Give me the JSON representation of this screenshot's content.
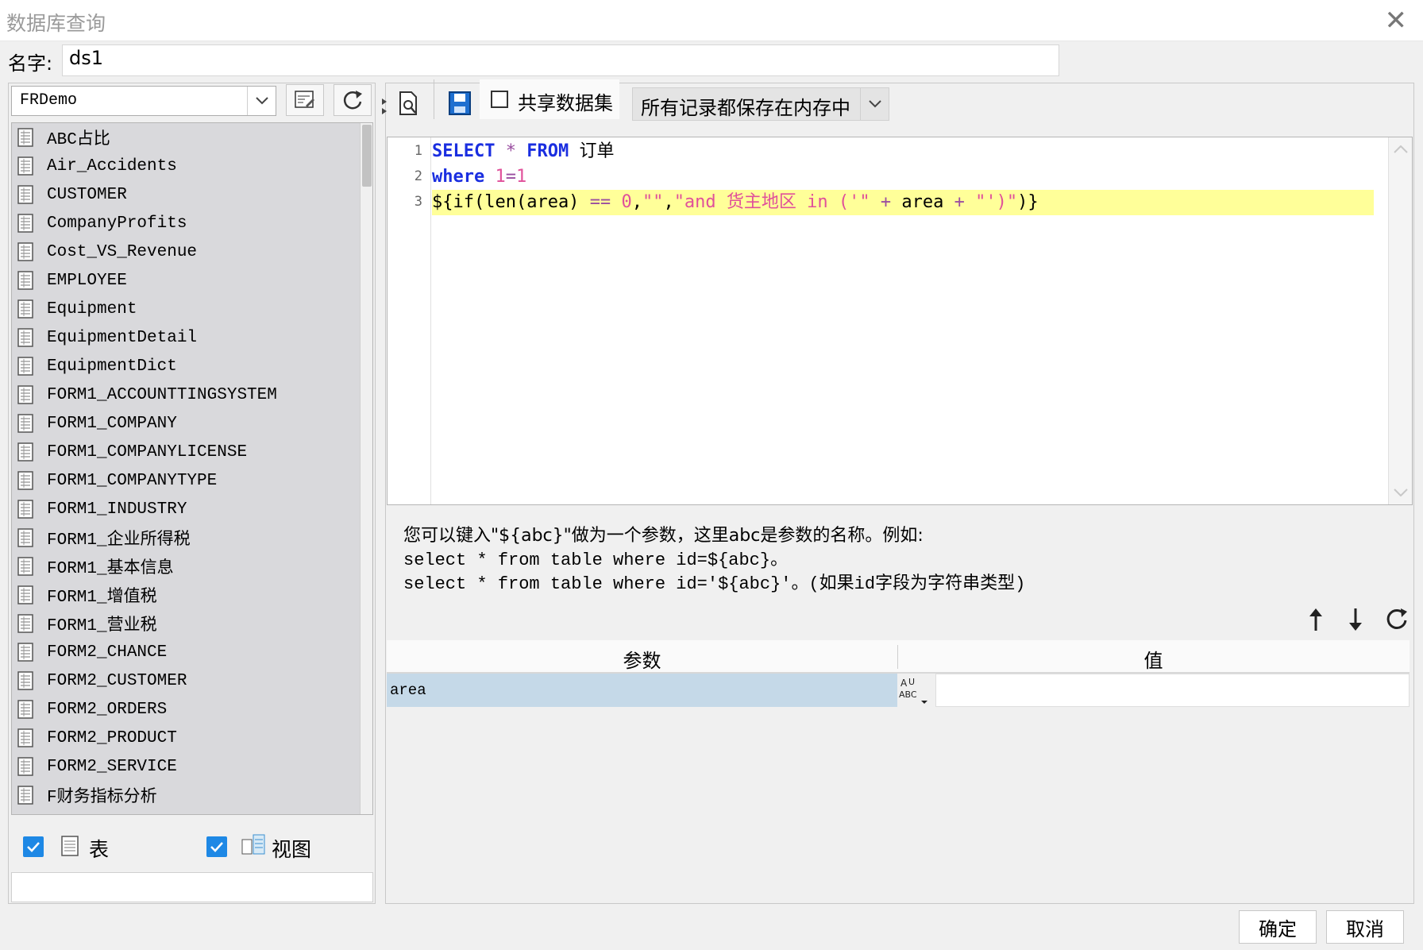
{
  "window": {
    "title": "数据库查询",
    "close_glyph": "✕"
  },
  "name_row": {
    "label": "名字:",
    "value": "ds1"
  },
  "left": {
    "datasource_value": "FRDemo",
    "tables": [
      "ABC占比",
      "Air_Accidents",
      "CUSTOMER",
      "CompanyProfits",
      "Cost_VS_Revenue",
      "EMPLOYEE",
      "Equipment",
      "EquipmentDetail",
      "EquipmentDict",
      "FORM1_ACCOUNTTINGSYSTEM",
      "FORM1_COMPANY",
      "FORM1_COMPANYLICENSE",
      "FORM1_COMPANYTYPE",
      "FORM1_INDUSTRY",
      "FORM1_企业所得税",
      "FORM1_基本信息",
      "FORM1_增值税",
      "FORM1_营业税",
      "FORM2_CHANCE",
      "FORM2_CUSTOMER",
      "FORM2_ORDERS",
      "FORM2_PRODUCT",
      "FORM2_SERVICE",
      "F财务指标分析"
    ],
    "filter": {
      "table_label": "表",
      "view_label": "视图"
    }
  },
  "toolbar": {
    "share_label": "共享数据集",
    "cache_mode": "所有记录都保存在内存中"
  },
  "editor": {
    "line_numbers": [
      "1",
      "2",
      "3"
    ]
  },
  "hints": {
    "line1": "您可以键入\"${abc}\"做为一个参数，这里abc是参数的名称。例如:",
    "line2": "select * from table where id=${abc}。",
    "line3": "select * from table where id='${abc}'。(如果id字段为字符串类型)"
  },
  "params_table": {
    "col_param": "参数",
    "col_value": "值",
    "rows": [
      {
        "name": "area",
        "value": ""
      }
    ]
  },
  "buttons": {
    "ok": "确定",
    "cancel": "取消"
  },
  "colors": {
    "accent": "#1e88e5",
    "selection": "#c5d9e8",
    "highlight_line": "#ffff99",
    "keyword": "#1a2ee0",
    "string": "#e0509a"
  }
}
